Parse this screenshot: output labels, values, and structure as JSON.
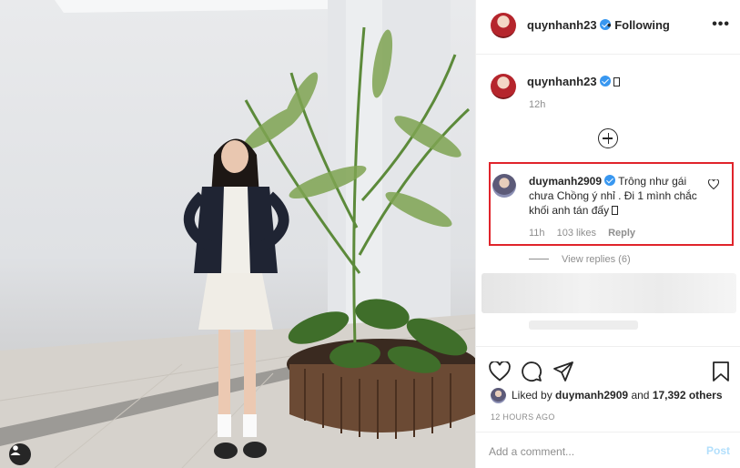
{
  "post": {
    "author": "quynhanh23",
    "separator": "•",
    "follow_status": "Following",
    "more_label": "•••"
  },
  "caption": {
    "author": "quynhanh23",
    "time": "12h"
  },
  "comment": {
    "author": "duymanh2909",
    "text": "Trông như gái chưa Chồng ý nhỉ . Đi 1 mình chắc khối anh tán đấy",
    "time": "11h",
    "likes": "103 likes",
    "reply_label": "Reply",
    "view_replies": "View replies (6)",
    "highlight_color": "#e0242b"
  },
  "actions": {
    "icons": [
      "heart-icon",
      "comment-icon",
      "share-icon",
      "bookmark-icon"
    ]
  },
  "likes": {
    "prefix": "Liked by",
    "user": "duymanh2909",
    "joiner": "and",
    "others": "17,392 others"
  },
  "posted_date": "12 HOURS AGO",
  "add_comment": {
    "placeholder": "Add a comment...",
    "post_label": "Post"
  },
  "colors": {
    "verified": "#3897f0",
    "post_button": "#b2dffc",
    "muted": "#8e8e8e"
  }
}
